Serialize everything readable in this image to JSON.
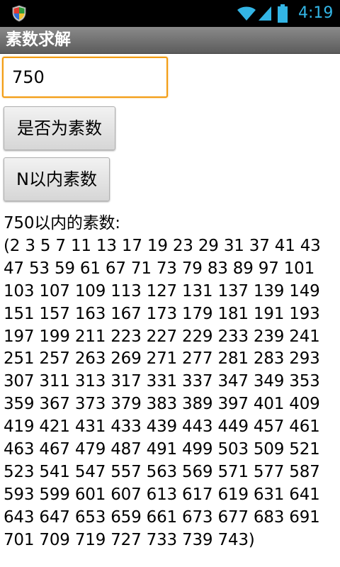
{
  "status_bar": {
    "time": "4:19",
    "icons": [
      "shield-icon",
      "wifi-icon",
      "signal-icon",
      "battery-icon"
    ],
    "clock_color": "#33b5e5"
  },
  "app": {
    "title": "素数求解"
  },
  "input": {
    "value": "750"
  },
  "buttons": {
    "check_prime": "是否为素数",
    "primes_within_n": "N以内素数"
  },
  "result": {
    "lines": [
      "750以内的素数:",
      "(2 3 5 7 11 13 17 19 23 29 31 37 41 43",
      "47 53 59 61 67 71 73 79 83 89 97 101",
      "103 107 109 113 127 131 137 139 149",
      "151 157 163 167 173 179 181 191 193",
      "197 199 211 223 227 229 233 239 241",
      "251 257 263 269 271 277 281 283 293",
      "307 311 313 317 331 337 347 349 353",
      "359 367 373 379 383 389 397 401 409",
      "419 421 431 433 439 443 449 457 461",
      "463 467 479 487 491 499 503 509 521",
      "523 541 547 557 563 569 571 577 587",
      "593 599 601 607 613 617 619 631 641",
      "643 647 653 659 661 673 677 683 691",
      "701 709 719 727 733 739 743)"
    ]
  },
  "colors": {
    "input_focus_border": "#f39c12",
    "title_bar": "#6e6e6e"
  }
}
